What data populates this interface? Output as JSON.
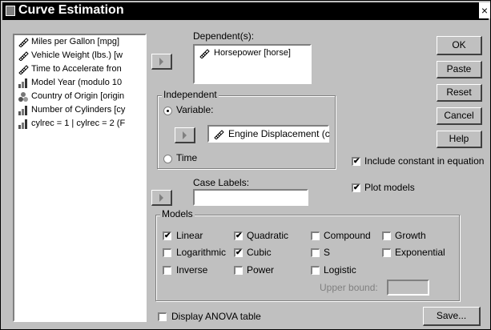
{
  "window": {
    "title": "Curve Estimation",
    "close_glyph": "×"
  },
  "variables": [
    {
      "label": "Miles per Gallon [mpg]",
      "icon": "scale-icon"
    },
    {
      "label": "Vehicle Weight (lbs.) [w",
      "icon": "scale-icon"
    },
    {
      "label": "Time to Accelerate fron",
      "icon": "scale-icon"
    },
    {
      "label": "Model Year (modulo 10",
      "icon": "ordinal-icon"
    },
    {
      "label": "Country of Origin [origin",
      "icon": "nominal-icon"
    },
    {
      "label": "Number of Cylinders [cy",
      "icon": "ordinal-icon"
    },
    {
      "label": "cylrec = 1 | cylrec = 2 (F",
      "icon": "ordinal-icon"
    }
  ],
  "dependent": {
    "label": "Dependent(s):",
    "value": "Horsepower [horse]"
  },
  "independent": {
    "title": "Independent",
    "variable_label": "Variable:",
    "variable_value": "Engine Displacement (c",
    "time_label": "Time",
    "selected": "variable"
  },
  "case_labels": {
    "label": "Case Labels:",
    "value": ""
  },
  "buttons": {
    "ok": "OK",
    "paste": "Paste",
    "reset": "Reset",
    "cancel": "Cancel",
    "help": "Help",
    "save": "Save..."
  },
  "options": {
    "include_constant": {
      "label": "Include constant in equation",
      "checked": true
    },
    "plot_models": {
      "label": "Plot models",
      "checked": true
    },
    "display_anova": {
      "label": "Display ANOVA table",
      "checked": false
    }
  },
  "models": {
    "title": "Models",
    "items": [
      {
        "label": "Linear",
        "checked": true
      },
      {
        "label": "Quadratic",
        "checked": true
      },
      {
        "label": "Compound",
        "checked": false
      },
      {
        "label": "Growth",
        "checked": false
      },
      {
        "label": "Logarithmic",
        "checked": false
      },
      {
        "label": "Cubic",
        "checked": true
      },
      {
        "label": "S",
        "checked": false
      },
      {
        "label": "Exponential",
        "checked": false
      },
      {
        "label": "Inverse",
        "checked": false
      },
      {
        "label": "Power",
        "checked": false
      },
      {
        "label": "Logistic",
        "checked": false
      }
    ],
    "upper_bound_label": "Upper bound:",
    "upper_bound_value": ""
  },
  "colors": {
    "face": "#c0c0c0",
    "shadow": "#808080",
    "title_bg": "#000000"
  }
}
